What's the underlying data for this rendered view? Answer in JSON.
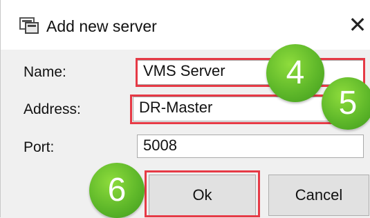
{
  "window": {
    "title": "Add new server",
    "close_glyph": "✕",
    "icon": "server-app-icon"
  },
  "form": {
    "name_label": "Name:",
    "name_value": "VMS Server",
    "address_label": "Address:",
    "address_value": "DR-Master",
    "port_label": "Port:",
    "port_value": "5008"
  },
  "buttons": {
    "ok_label": "Ok",
    "cancel_label": "Cancel"
  },
  "callouts": {
    "step_name": "4",
    "step_address": "5",
    "step_ok": "6"
  },
  "colors": {
    "highlight": "#e63a46",
    "callout_badge": "#5fb82a"
  }
}
